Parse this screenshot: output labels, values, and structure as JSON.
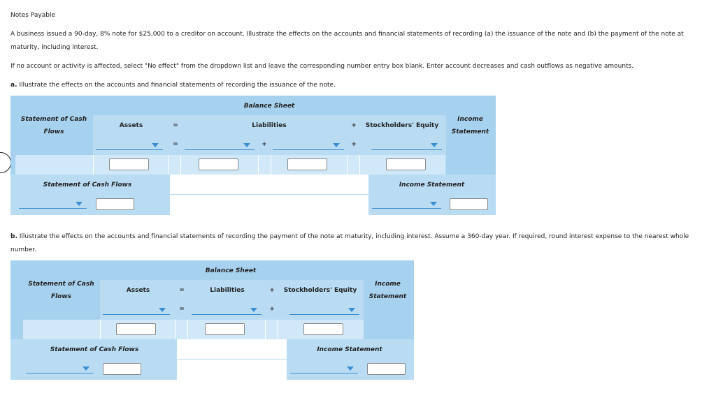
{
  "page": {
    "title": "Notes Payable",
    "intro": "A business issued a 90-day, 8% note for $25,000 to a creditor on account. Illustrate the effects on the accounts and financial statements of recording (a) the issuance of the note and (b) the payment of the note at maturity, including interest.",
    "instructions": "If no account or activity is affected, select \"No effect\" from the dropdown list and leave the corresponding number entry box blank. Enter account decreases and cash outflows as negative amounts."
  },
  "part_a": {
    "label": "a.",
    "text": "Illustrate the effects on the accounts and financial statements of recording the issuance of the note.",
    "table": {
      "scf_header": "Statement of Cash Flows",
      "balance_sheet": "Balance Sheet",
      "assets": "Assets",
      "liabilities": "Liabilities",
      "equity": "Stockholders' Equity",
      "income_statement": "Income Statement",
      "eq": "=",
      "plus": "+",
      "scf_footer": "Statement of Cash Flows",
      "is_footer": "Income Statement",
      "dropdowns": {
        "assets": "",
        "liabilities_1": "",
        "liabilities_2": "",
        "equity": "",
        "scf": "",
        "is": ""
      },
      "inputs": {
        "assets": "",
        "liabilities_1": "",
        "liabilities_2": "",
        "equity": "",
        "scf": "",
        "is": ""
      }
    }
  },
  "part_b": {
    "label": "b.",
    "text": "Illustrate the effects on the accounts and financial statements of recording the payment of the note at maturity, including interest. Assume a 360-day year. If required, round interest expense to the nearest whole number.",
    "table": {
      "scf_header": "Statement of Cash Flows",
      "balance_sheet": "Balance Sheet",
      "assets": "Assets",
      "liabilities": "Liabilities",
      "equity": "Stockholders' Equity",
      "income_statement": "Income Statement",
      "eq": "=",
      "plus": "+",
      "scf_footer": "Statement of Cash Flows",
      "is_footer": "Income Statement",
      "dropdowns": {
        "assets": "",
        "liabilities": "",
        "equity": "",
        "scf": "",
        "is": ""
      },
      "inputs": {
        "assets": "",
        "liabilities": "",
        "equity": "",
        "scf": "",
        "is": ""
      }
    }
  }
}
